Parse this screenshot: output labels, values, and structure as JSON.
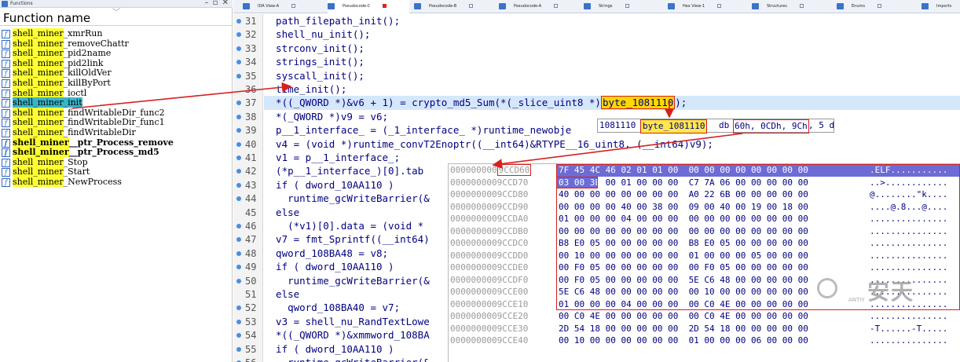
{
  "functions_panel": {
    "title": "Functions",
    "column_header": "Function name",
    "items": [
      {
        "prefix": "shell_miner",
        "suffix": "_xmrRun",
        "bold": false,
        "selected": false
      },
      {
        "prefix": "shell_miner",
        "suffix": "_removeChattr",
        "bold": false,
        "selected": false
      },
      {
        "prefix": "shell_miner",
        "suffix": "_pid2name",
        "bold": false,
        "selected": false
      },
      {
        "prefix": "shell_miner",
        "suffix": "_pid2link",
        "bold": false,
        "selected": false
      },
      {
        "prefix": "shell_miner",
        "suffix": "_killOldVer",
        "bold": false,
        "selected": false
      },
      {
        "prefix": "shell_miner",
        "suffix": "_killByPort",
        "bold": false,
        "selected": false
      },
      {
        "prefix": "shell_miner",
        "suffix": "_ioctl",
        "bold": false,
        "selected": false
      },
      {
        "prefix": "shell_miner",
        "suffix": "_init",
        "bold": false,
        "selected": true
      },
      {
        "prefix": "shell_miner",
        "suffix": "_findWritableDir_func2",
        "bold": false,
        "selected": false
      },
      {
        "prefix": "shell_miner",
        "suffix": "_findWritableDir_func1",
        "bold": false,
        "selected": false
      },
      {
        "prefix": "shell_miner",
        "suffix": "_findWritableDir",
        "bold": false,
        "selected": false
      },
      {
        "prefix": "shell_miner",
        "suffix": "__ptr_Process_remove",
        "bold": true,
        "selected": false
      },
      {
        "prefix": "shell_miner",
        "suffix": "__ptr_Process_md5",
        "bold": true,
        "selected": false
      },
      {
        "prefix": "shell_miner",
        "suffix": "_Stop",
        "bold": false,
        "selected": false
      },
      {
        "prefix": "shell_miner",
        "suffix": "_Start",
        "bold": false,
        "selected": false
      },
      {
        "prefix": "shell_miner",
        "suffix": "_NewProcess",
        "bold": false,
        "selected": false
      }
    ]
  },
  "tabs": [
    {
      "label": "IDA View-A",
      "active": false
    },
    {
      "label": "Pseudocode-C",
      "active": true
    },
    {
      "label": "Pseudocode-B",
      "active": false
    },
    {
      "label": "Pseudocode-A",
      "active": false
    },
    {
      "label": "Strings",
      "active": false
    },
    {
      "label": "Hex View-1",
      "active": false
    },
    {
      "label": "Structures",
      "active": false
    },
    {
      "label": "Enums",
      "active": false
    },
    {
      "label": "Imports",
      "active": false
    }
  ],
  "code_lines": [
    {
      "num": "31",
      "text": "  path_filepath_init();",
      "dot": true
    },
    {
      "num": "32",
      "text": "  shell_nu_init();",
      "dot": true
    },
    {
      "num": "33",
      "text": "  strconv_init();",
      "dot": true
    },
    {
      "num": "34",
      "text": "  strings_init();",
      "dot": true
    },
    {
      "num": "35",
      "text": "  syscall_init();",
      "dot": true
    },
    {
      "num": "36",
      "text": "  time_init();",
      "dot": false
    },
    {
      "num": "37",
      "text_before": "  *((_QWORD *)&v6 + 1) = crypto_md5_Sum(*(_slice_uint8 *)",
      "text_hl": "byte_1081110",
      "text_after": ");",
      "dot": true,
      "current": true
    },
    {
      "num": "38",
      "text": "  *(_QWORD *)v9 = v6;",
      "dot": true
    },
    {
      "num": "39",
      "text": "  p__1_interface_ = (_1_interface_ *)runtime_newobje",
      "dot": true
    },
    {
      "num": "40",
      "text": "  v4 = (void *)runtime_convT2Enoptr((__int64)&RTYPE__16_uint8, (__int64)v9);",
      "dot": true
    },
    {
      "num": "41",
      "text": "  v1 = p__1_interface_;",
      "dot": true
    },
    {
      "num": "42",
      "text": "  (*p__1_interface_)[0].tab",
      "dot": true
    },
    {
      "num": "43",
      "text": "  if ( dword_10AA110 )",
      "dot": true
    },
    {
      "num": "44",
      "text": "    runtime_gcWriteBarrier(&",
      "dot": true
    },
    {
      "num": "45",
      "text": "  else",
      "dot": false
    },
    {
      "num": "46",
      "text": "    (*v1)[0].data = (void *",
      "dot": true
    },
    {
      "num": "47",
      "text": "  v7 = fmt_Sprintf((__int64)",
      "dot": true
    },
    {
      "num": "48",
      "text": "  qword_108BA48 = v8;",
      "dot": true
    },
    {
      "num": "49",
      "text": "  if ( dword_10AA110 )",
      "dot": true
    },
    {
      "num": "50",
      "text": "    runtime_gcWriteBarrier(&",
      "dot": true
    },
    {
      "num": "51",
      "text": "  else",
      "dot": false
    },
    {
      "num": "52",
      "text": "    qword_108BA40 = v7;",
      "dot": true
    },
    {
      "num": "53",
      "text": "  v3 = shell_nu_RandTextLowe",
      "dot": true
    },
    {
      "num": "54",
      "text": "  *((_QWORD *)&xmmword_108BA",
      "dot": true
    },
    {
      "num": "55",
      "text": "  if ( dword_10AA110 )",
      "dot": true
    },
    {
      "num": "56",
      "text": "    runtime_gcWriteBarrier(&",
      "dot": true
    }
  ],
  "tooltip": {
    "addr": "1081110",
    "name": "byte_1081110",
    "directive": "db",
    "value": "60h, 0CDh, 9Ch",
    "tail": ", 5 d"
  },
  "hex_view": {
    "rows": [
      {
        "addr": "000000000",
        "addr_hl": "9CCD60",
        "hex": "7F 45 4C 46 02 01 01 00  00 00 00 00 00 00 00 00",
        "ascii": ".ELF..........."
      },
      {
        "addr": "000000000",
        "addr_hl": "9CCD70",
        "hex": "03 00 3E 00 01 00 00 00  C7 7A 06 00 00 00 00 00",
        "ascii": "..>............"
      },
      {
        "addr": "000000000",
        "addr_hl": "9CCD80",
        "hex": "40 00 00 00 00 00 00 00  A0 22 6B 00 00 00 00 00",
        "ascii": "@........\"k...."
      },
      {
        "addr": "000000000",
        "addr_hl": "9CCD90",
        "hex": "00 00 00 00 40 00 38 00  09 00 40 00 19 00 18 00",
        "ascii": "....@.8...@...."
      },
      {
        "addr": "000000000",
        "addr_hl": "9CCDA0",
        "hex": "01 00 00 00 04 00 00 00  00 00 00 00 00 00 00 00",
        "ascii": "..............."
      },
      {
        "addr": "000000000",
        "addr_hl": "9CCDB0",
        "hex": "00 00 00 00 00 00 00 00  00 00 00 00 00 00 00 00",
        "ascii": "..............."
      },
      {
        "addr": "000000000",
        "addr_hl": "9CCDC0",
        "hex": "B8 E0 05 00 00 00 00 00  B8 E0 05 00 00 00 00 00",
        "ascii": "..............."
      },
      {
        "addr": "000000000",
        "addr_hl": "9CCDD0",
        "hex": "00 10 00 00 00 00 00 00  01 00 00 00 05 00 00 00",
        "ascii": "..............."
      },
      {
        "addr": "000000000",
        "addr_hl": "9CCDE0",
        "hex": "00 F0 05 00 00 00 00 00  00 F0 05 00 00 00 00 00",
        "ascii": "..............."
      },
      {
        "addr": "000000000",
        "addr_hl": "9CCDF0",
        "hex": "00 F0 05 00 00 00 00 00  5E C6 48 00 00 00 00 00",
        "ascii": "..............."
      },
      {
        "addr": "000000000",
        "addr_hl": "9CCE00",
        "hex": "5E C6 48 00 00 00 00 00  00 10 00 00 00 00 00 00",
        "ascii": "..............."
      },
      {
        "addr": "000000000",
        "addr_hl": "9CCE10",
        "hex": "01 00 00 00 04 00 00 00  00 C0 4E 00 00 00 00 00",
        "ascii": "..............."
      },
      {
        "addr": "000000000",
        "addr_hl": "9CCE20",
        "hex": "00 C0 4E 00 00 00 00 00  00 C0 4E 00 00 00 00 00",
        "ascii": "..............."
      },
      {
        "addr": "000000000",
        "addr_hl": "9CCE30",
        "hex": "2D 54 18 00 00 00 00 00  2D 54 18 00 00 00 00 00",
        "ascii": "-T......-T....."
      },
      {
        "addr": "000000000",
        "addr_hl": "9CCE40",
        "hex": "00 10 00 00 00 00 00 00  01 00 00 00 06 00 00 00",
        "ascii": "..............."
      }
    ]
  },
  "watermark": {
    "text": "安天",
    "sub": "ANTIY"
  },
  "colors": {
    "accent_red": "#d62020",
    "hex_selection": "#6d6bd6",
    "name_highlight": "#ffff33",
    "selected_row": "#38b5c7",
    "code_text": "#000080"
  }
}
